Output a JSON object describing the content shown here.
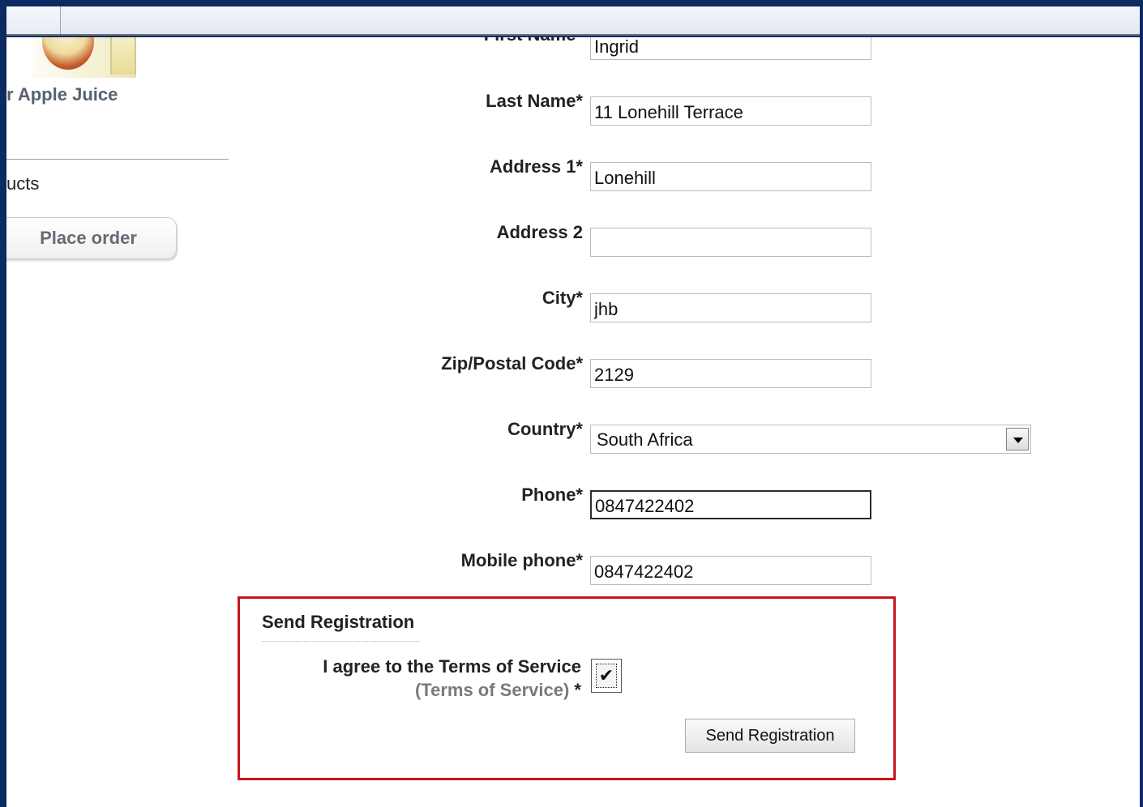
{
  "sidebar": {
    "product_name": "r Apple Juice",
    "link_label": "ucts",
    "place_order_label": "Place order"
  },
  "form": {
    "first_name": {
      "label": "First Name*",
      "value": "Ingrid"
    },
    "last_name": {
      "label": "Last Name*",
      "value": "11 Lonehill Terrace"
    },
    "address1": {
      "label": "Address 1*",
      "value": "Lonehill"
    },
    "address2": {
      "label": "Address 2",
      "value": ""
    },
    "city": {
      "label": "City*",
      "value": "jhb"
    },
    "zip": {
      "label": "Zip/Postal Code*",
      "value": "2129"
    },
    "country": {
      "label": "Country*",
      "value": "South Africa"
    },
    "phone": {
      "label": "Phone*",
      "value": "0847422402"
    },
    "mobile": {
      "label": "Mobile phone*",
      "value": "0847422402"
    }
  },
  "registration": {
    "title": "Send Registration",
    "tos_label": "I agree to the Terms of Service",
    "tos_link": "(Terms of Service)",
    "tos_required": " *",
    "checkbox_checked": true,
    "checkbox_glyph": "✔",
    "button_label": "Send Registration",
    "highlight_color": "#c4161c"
  },
  "colors": {
    "frame": "#0c2a63",
    "page": "#ffffff"
  }
}
